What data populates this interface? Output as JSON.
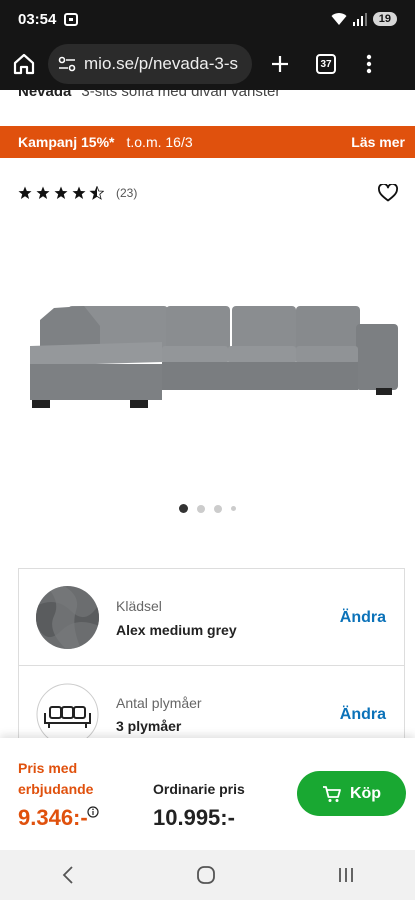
{
  "status": {
    "time": "03:54",
    "battery": "19"
  },
  "browser": {
    "url": "mio.se/p/nevada-3-s",
    "tab_count": "37"
  },
  "product": {
    "name": "Nevada",
    "subtitle": "3-sits soffa med divan vänster"
  },
  "promo": {
    "label": "Kampanj 15%*",
    "period": "t.o.m. 16/3",
    "link": "Läs mer",
    "color": "#e0510d"
  },
  "rating": {
    "stars": "★★★★★",
    "value": 4.5,
    "count": "(23)"
  },
  "gallery": {
    "total_images": 4,
    "active_index": 0
  },
  "options": [
    {
      "label": "Klädsel",
      "value": "Alex medium grey",
      "action": "Ändra"
    },
    {
      "label": "Antal plymåer",
      "value": "3 plymåer",
      "action": "Ändra"
    }
  ],
  "pricing": {
    "offer_label": "Pris med erbjudande",
    "offer_price": "9.346:-",
    "ordinary_label": "Ordinarie pris",
    "ordinary_price": "10.995:-",
    "buy_label": "Köp",
    "buy_color": "#19a832"
  },
  "icons": [
    "home-icon",
    "site-settings-icon",
    "new-tab-icon",
    "tabs-icon",
    "menu-icon",
    "heart-icon",
    "info-icon",
    "cart-icon",
    "back-icon",
    "home-nav-icon",
    "recents-icon"
  ]
}
